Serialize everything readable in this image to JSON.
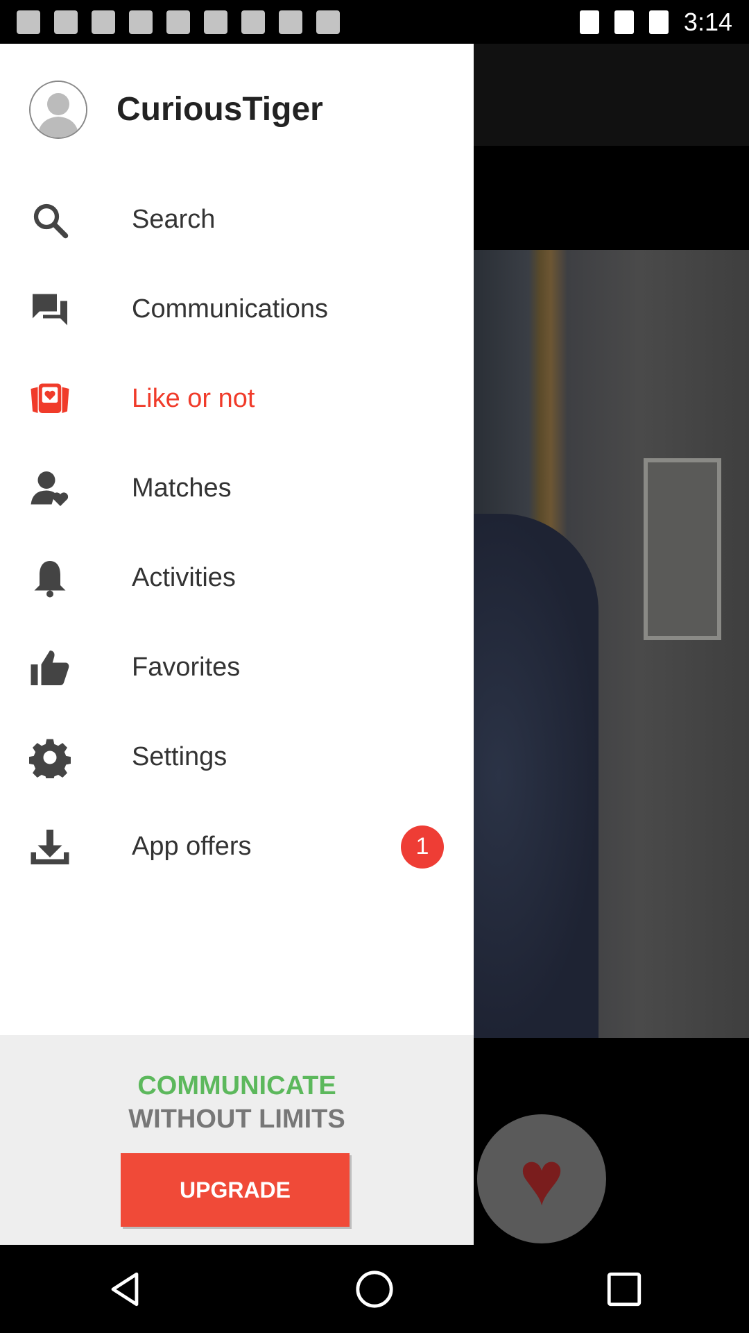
{
  "status_bar": {
    "time": "3:14"
  },
  "drawer": {
    "username": "CuriousTiger",
    "menu": [
      {
        "label": "Search",
        "icon": "search-icon"
      },
      {
        "label": "Communications",
        "icon": "chat-icon"
      },
      {
        "label": "Like or not",
        "icon": "like-card-icon",
        "active": true
      },
      {
        "label": "Matches",
        "icon": "person-heart-icon"
      },
      {
        "label": "Activities",
        "icon": "bell-icon"
      },
      {
        "label": "Favorites",
        "icon": "thumbs-up-icon"
      },
      {
        "label": "Settings",
        "icon": "gear-icon"
      },
      {
        "label": "App offers",
        "icon": "download-icon",
        "badge": "1"
      }
    ],
    "promo": {
      "line1": "COMMUNICATE",
      "line2": "WITHOUT LIMITS",
      "button": "UPGRADE"
    }
  },
  "colors": {
    "accent": "#f03b2a",
    "promo_green": "#5cb85c",
    "upgrade_button": "#f04a38",
    "badge": "#ee3d35"
  }
}
